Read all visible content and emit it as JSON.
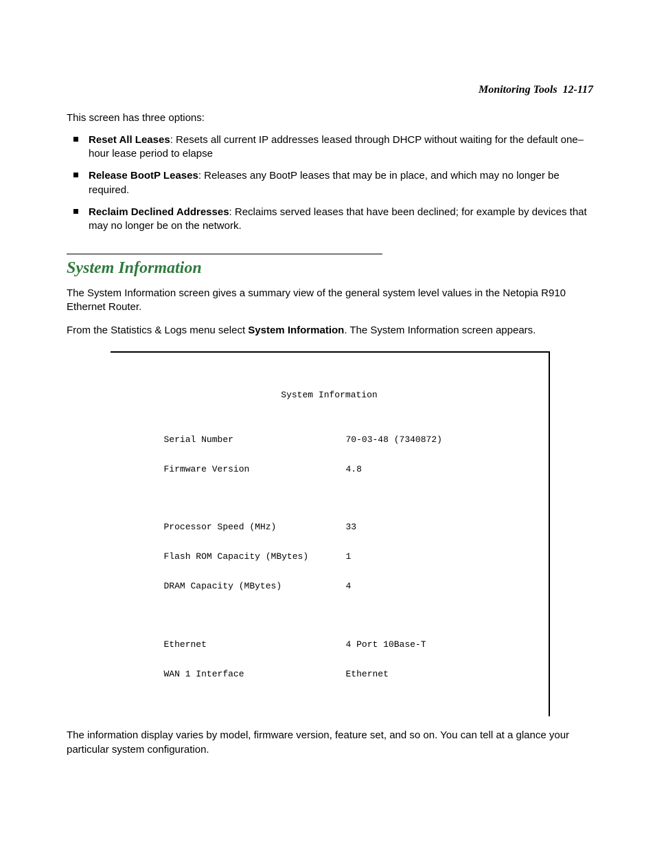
{
  "header": {
    "section": "Monitoring Tools",
    "page": "12-117"
  },
  "intro": "This screen has three options:",
  "options": [
    {
      "term": "Reset All Leases",
      "desc": ": Resets all current IP addresses leased through DHCP without waiting for the default one–hour lease period to elapse"
    },
    {
      "term": "Release BootP Leases",
      "desc": ": Releases any BootP leases that may be in place, and which may no longer be required."
    },
    {
      "term": "Reclaim Declined Addresses",
      "desc": ": Reclaims served leases that have been declined; for example by devices that may no longer be on the network."
    }
  ],
  "section_title": "System Information",
  "para1": "The System Information screen gives a summary view of the general system level values in the Netopia R910 Ethernet Router.",
  "para2_pre": "From the Statistics & Logs menu select ",
  "para2_bold": "System Information",
  "para2_post": ". The System Information screen appears.",
  "terminal": {
    "title": "System Information",
    "rows": [
      {
        "label": "Serial Number",
        "value": "70-03-48 (7340872)"
      },
      {
        "label": "Firmware Version",
        "value": "4.8"
      }
    ],
    "rows2": [
      {
        "label": "Processor Speed (MHz)",
        "value": "33"
      },
      {
        "label": "Flash ROM Capacity (MBytes)",
        "value": "1"
      },
      {
        "label": "DRAM Capacity (MBytes)",
        "value": "4"
      }
    ],
    "rows3": [
      {
        "label": "Ethernet",
        "value": "4 Port 10Base-T"
      },
      {
        "label": "WAN 1 Interface",
        "value": "Ethernet"
      }
    ]
  },
  "para3": "The information display varies by model, firmware version, feature set, and so on. You can tell at a glance your particular system configuration."
}
